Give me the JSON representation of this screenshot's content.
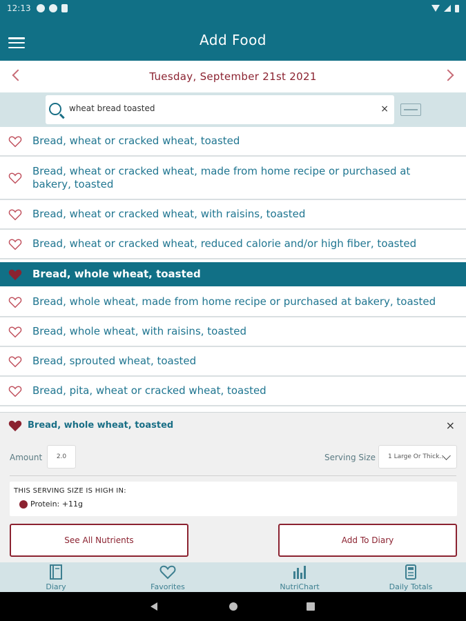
{
  "status": {
    "time": "12:13"
  },
  "appbar": {
    "title": "Add Food"
  },
  "date": {
    "label": "Tuesday, September 21st 2021"
  },
  "search": {
    "query": "wheat bread toasted",
    "clear": "×"
  },
  "results": [
    {
      "label": "Bread, wheat or cracked wheat, toasted",
      "favorite": false,
      "selected": false
    },
    {
      "label": "Bread, wheat or cracked wheat, made from home recipe or purchased at bakery, toasted",
      "favorite": false,
      "selected": false
    },
    {
      "label": "Bread, wheat or cracked wheat, with raisins, toasted",
      "favorite": false,
      "selected": false
    },
    {
      "label": "Bread, wheat or cracked wheat, reduced calorie and/or high fiber, toasted",
      "favorite": false,
      "selected": false
    },
    {
      "label": "Bread, whole wheat, toasted",
      "favorite": true,
      "selected": true
    },
    {
      "label": "Bread, whole wheat, made from home recipe or purchased at bakery, toasted",
      "favorite": false,
      "selected": false
    },
    {
      "label": "Bread, whole wheat, with raisins, toasted",
      "favorite": false,
      "selected": false
    },
    {
      "label": "Bread, sprouted wheat, toasted",
      "favorite": false,
      "selected": false
    },
    {
      "label": "Bread, pita, wheat or cracked wheat, toasted",
      "favorite": false,
      "selected": false
    }
  ],
  "detail": {
    "title": "Bread, whole wheat, toasted",
    "close": "×",
    "amount_label": "Amount",
    "amount_value": "2.0",
    "serving_label": "Serving Size",
    "serving_value": "1 Large Or Thick...",
    "high_title": "THIS SERVING SIZE IS HIGH IN:",
    "high_item": "Protein: +11g",
    "see_nutrients": "See All Nutrients",
    "add_to_diary": "Add To Diary"
  },
  "nav": {
    "diary": "Diary",
    "favorites": "Favorites",
    "nutrichart": "NutriChart",
    "daily_totals": "Daily Totals"
  },
  "colors": {
    "primary": "#117086",
    "accent": "#8b2230",
    "light": "#d3e3e6"
  }
}
